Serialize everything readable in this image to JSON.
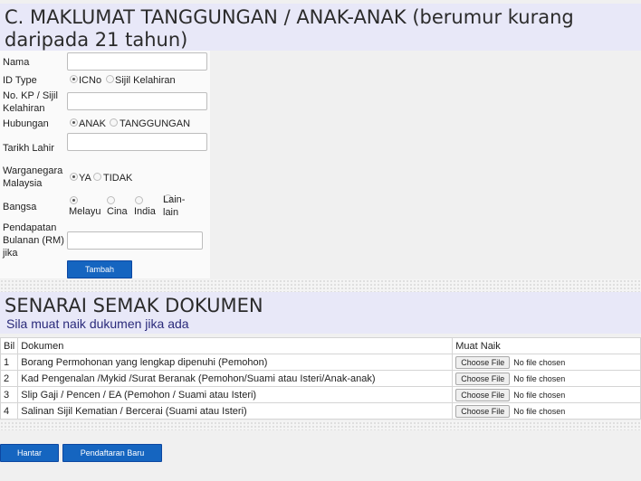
{
  "section_c": {
    "title": "C. MAKLUMAT TANGGUNGAN / ANAK-ANAK (berumur kurang daripada 21 tahun)",
    "labels": {
      "nama": "Nama",
      "id_type": "ID Type",
      "no_kp": "No. KP / Sijil Kelahiran",
      "hubungan": "Hubungan",
      "tarikh_lahir": "Tarikh Lahir",
      "warganegara": "Warganegara Malaysia",
      "bangsa": "Bangsa",
      "pendapatan": "Pendapatan Bulanan (RM) jika"
    },
    "id_type_options": [
      "ICNo",
      "Sijil Kelahiran"
    ],
    "hubungan_options": [
      "ANAK",
      "TANGGUNGAN"
    ],
    "warganegara_options": [
      "YA",
      "TIDAK"
    ],
    "bangsa_options": [
      "Melayu",
      "Cina",
      "India",
      "Lain-lain"
    ],
    "tambah_label": "Tambah"
  },
  "senarai": {
    "title": "SENARAI SEMAK DOKUMEN",
    "subtitle": "Sila muat naik dukumen jika ada",
    "headers": {
      "bil": "Bil",
      "dokumen": "Dokumen",
      "muat_naik": "Muat Naik"
    },
    "rows": [
      {
        "bil": "1",
        "dokumen": "Borang Permohonan yang lengkap dipenuhi (Pemohon)"
      },
      {
        "bil": "2",
        "dokumen": "Kad Pengenalan /Mykid /Surat Beranak (Pemohon/Suami atau Isteri/Anak-anak)"
      },
      {
        "bil": "3",
        "dokumen": "Slip Gaji / Pencen / EA (Pemohon / Suami atau Isteri)"
      },
      {
        "bil": "4",
        "dokumen": "Salinan Sijil Kematian / Bercerai (Suami atau Isteri)"
      }
    ],
    "choose_file": "Choose File",
    "no_file": "No file chosen"
  },
  "footer": {
    "hantar": "Hantar",
    "pendaftaran_baru": "Pendaftaran Baru"
  },
  "colors": {
    "button_blue": "#1565c0",
    "section_bg": "#e8e8f8"
  }
}
